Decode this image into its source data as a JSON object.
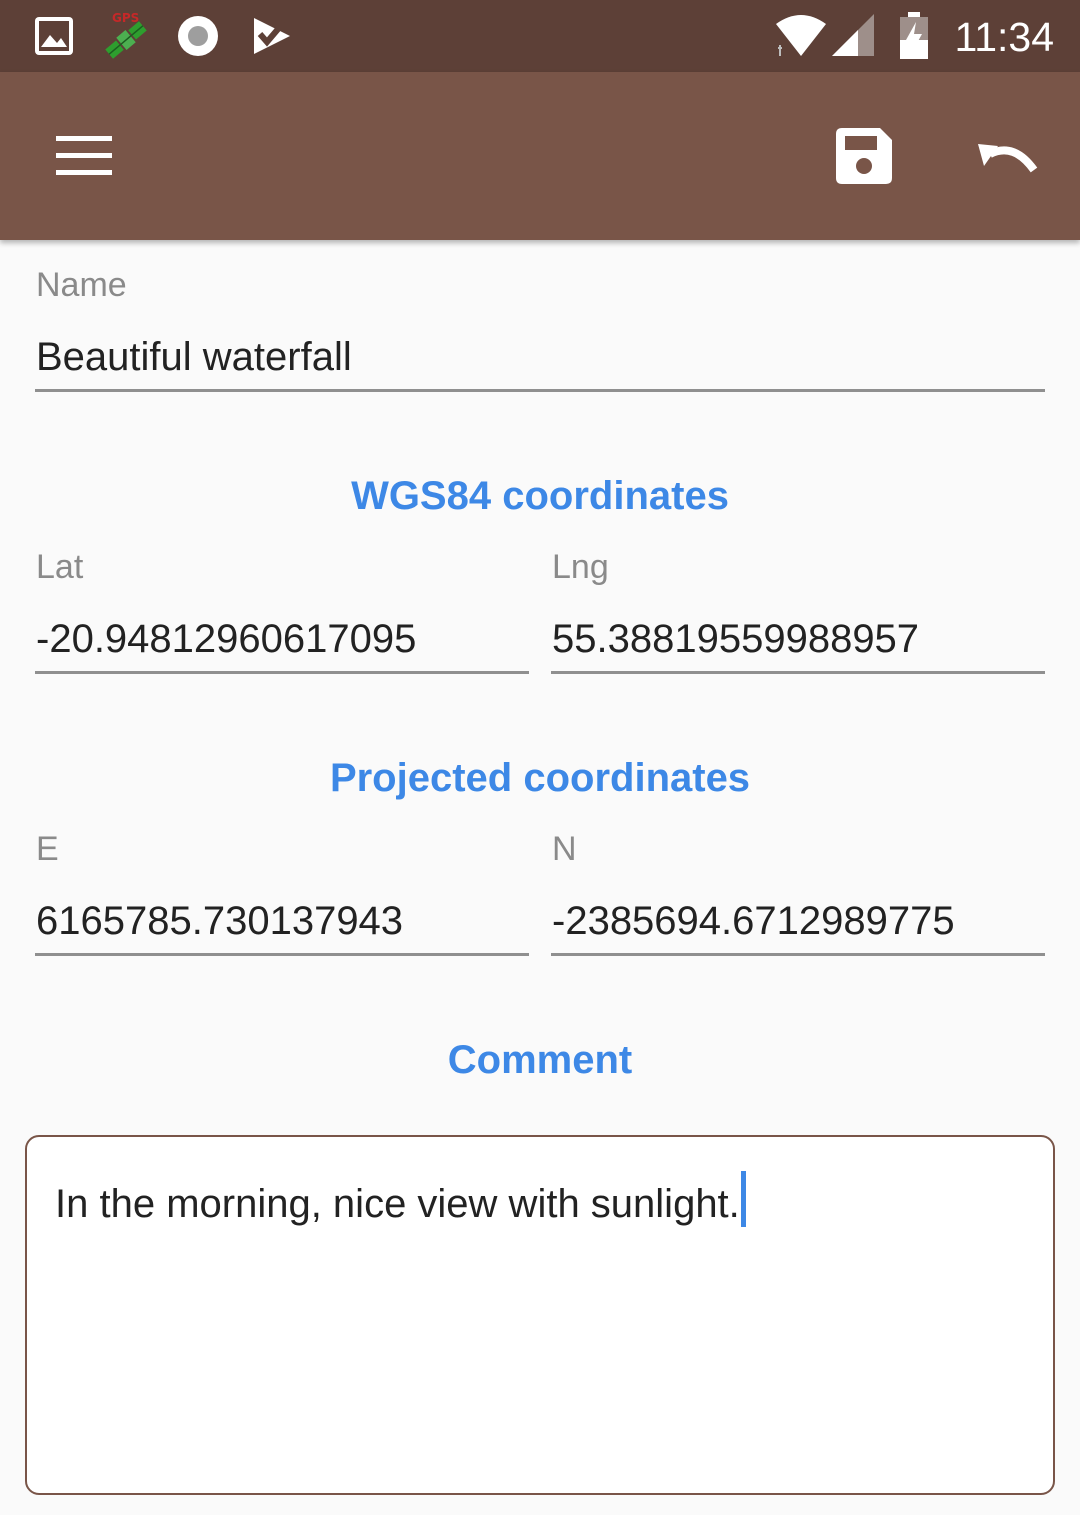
{
  "status_bar": {
    "time": "11:34",
    "icons": [
      "image-icon",
      "satellite-app-icon",
      "record-icon",
      "check-edit-icon",
      "wifi-icon",
      "signal-icon",
      "battery-charging-icon"
    ]
  },
  "app_bar": {
    "menu_icon": "hamburger-menu-icon",
    "save_icon": "save-icon",
    "undo_icon": "undo-icon"
  },
  "form": {
    "name": {
      "label": "Name",
      "value": "Beautiful waterfall"
    },
    "wgs84": {
      "title": "WGS84 coordinates",
      "lat": {
        "label": "Lat",
        "value": "-20.94812960617095"
      },
      "lng": {
        "label": "Lng",
        "value": "55.38819559988957"
      }
    },
    "projected": {
      "title": "Projected coordinates",
      "e": {
        "label": "E",
        "value": "6165785.730137943"
      },
      "n": {
        "label": "N",
        "value": "-2385694.6712989775"
      }
    },
    "comment": {
      "title": "Comment",
      "value": "In the morning, nice view with sunlight."
    }
  },
  "colors": {
    "status_bar": "#5d4037",
    "app_bar": "#795548",
    "accent": "#3d88e6",
    "background": "#fafafa"
  }
}
